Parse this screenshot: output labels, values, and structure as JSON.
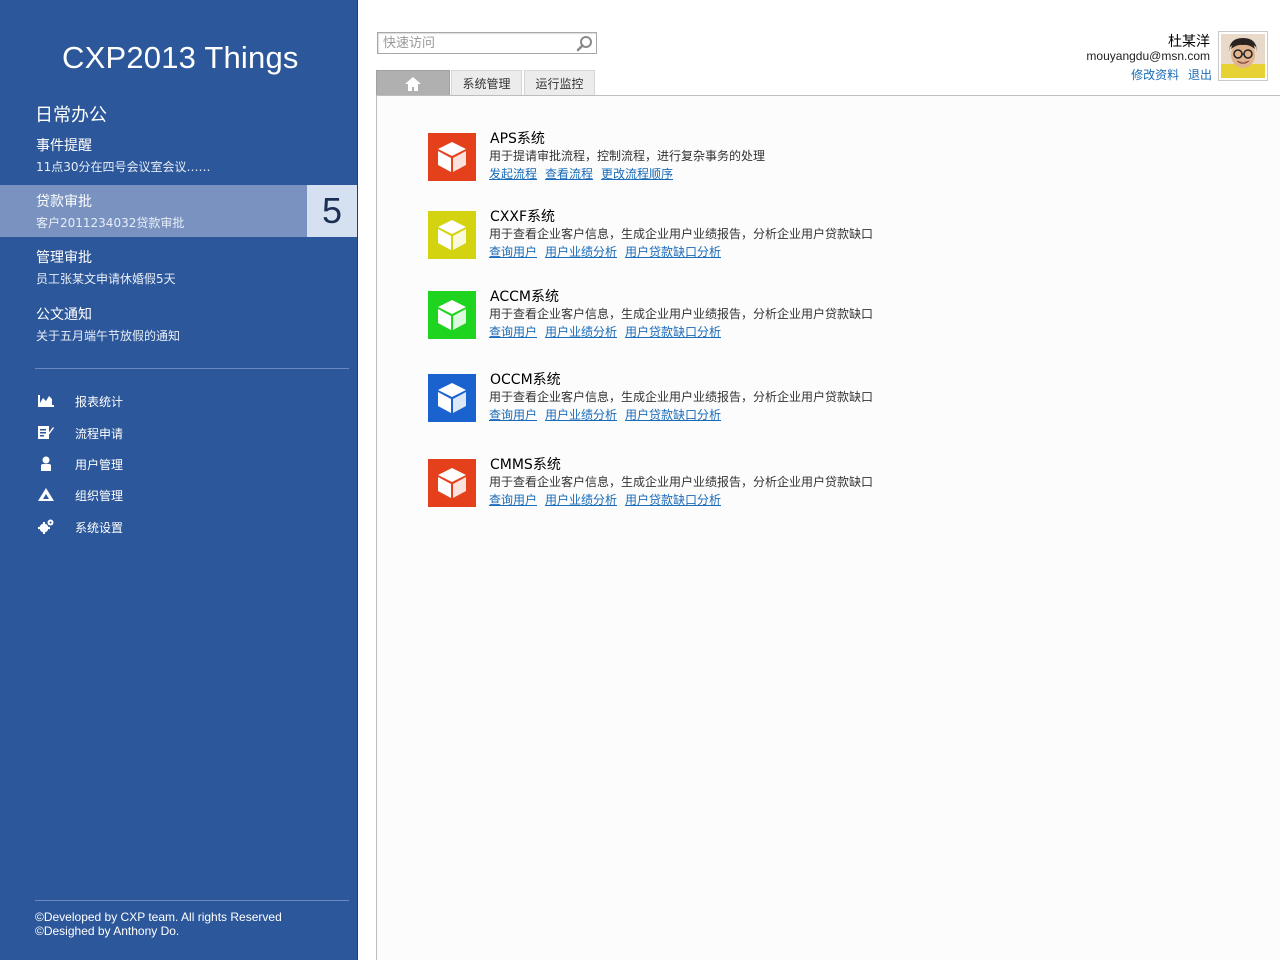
{
  "sidebar": {
    "app_title": "CXP2013 Things",
    "section_title": "日常办公",
    "notices": [
      {
        "title": "事件提醒",
        "desc": "11点30分在四号会议室会议……",
        "badge": ""
      },
      {
        "title": "贷款审批",
        "desc": "客户2011234032贷款审批",
        "badge": "5"
      },
      {
        "title": "管理审批",
        "desc": "员工张某文申请休婚假5天",
        "badge": ""
      },
      {
        "title": "公文通知",
        "desc": "关于五月端午节放假的通知",
        "badge": ""
      }
    ],
    "menu": [
      {
        "label": "报表统计",
        "icon": "chart-icon"
      },
      {
        "label": "流程申请",
        "icon": "form-icon"
      },
      {
        "label": "用户管理",
        "icon": "user-icon"
      },
      {
        "label": "组织管理",
        "icon": "org-icon"
      },
      {
        "label": "系统设置",
        "icon": "gear-icon"
      }
    ],
    "footer": {
      "line1": "©Developed by CXP team. All rights Reserved",
      "line2": "©Desighed by Anthony Do."
    }
  },
  "search": {
    "placeholder": "快速访问",
    "value": ""
  },
  "tabs": [
    {
      "label": "",
      "icon": "home-icon"
    },
    {
      "label": "系统管理"
    },
    {
      "label": "运行监控"
    }
  ],
  "user": {
    "name": "杜某洋",
    "email": "mouyangdu@msn.com",
    "edit_label": "修改资料",
    "logout_label": "退出"
  },
  "systems": [
    {
      "name": "APS系统",
      "desc": "用于提请审批流程，控制流程，进行复杂事务的处理",
      "color": "#e5401c",
      "links": [
        "发起流程",
        "查看流程",
        "更改流程顺序"
      ]
    },
    {
      "name": "CXXF系统",
      "desc": "用于查看企业客户信息，生成企业用户业绩报告，分析企业用户贷款缺口",
      "color": "#d3d40f",
      "links": [
        "查询用户",
        "用户业绩分析",
        "用户贷款缺口分析"
      ]
    },
    {
      "name": "ACCM系统",
      "desc": "用于查看企业客户信息，生成企业用户业绩报告，分析企业用户贷款缺口",
      "color": "#1fd41f",
      "links": [
        "查询用户",
        "用户业绩分析",
        "用户贷款缺口分析"
      ]
    },
    {
      "name": "OCCM系统",
      "desc": "用于查看企业客户信息，生成企业用户业绩报告，分析企业用户贷款缺口",
      "color": "#1a63cf",
      "links": [
        "查询用户",
        "用户业绩分析",
        "用户贷款缺口分析"
      ]
    },
    {
      "name": "CMMS系统",
      "desc": "用于查看企业客户信息，生成企业用户业绩报告，分析企业用户贷款缺口",
      "color": "#e5401c",
      "links": [
        "查询用户",
        "用户业绩分析",
        "用户贷款缺口分析"
      ]
    }
  ]
}
